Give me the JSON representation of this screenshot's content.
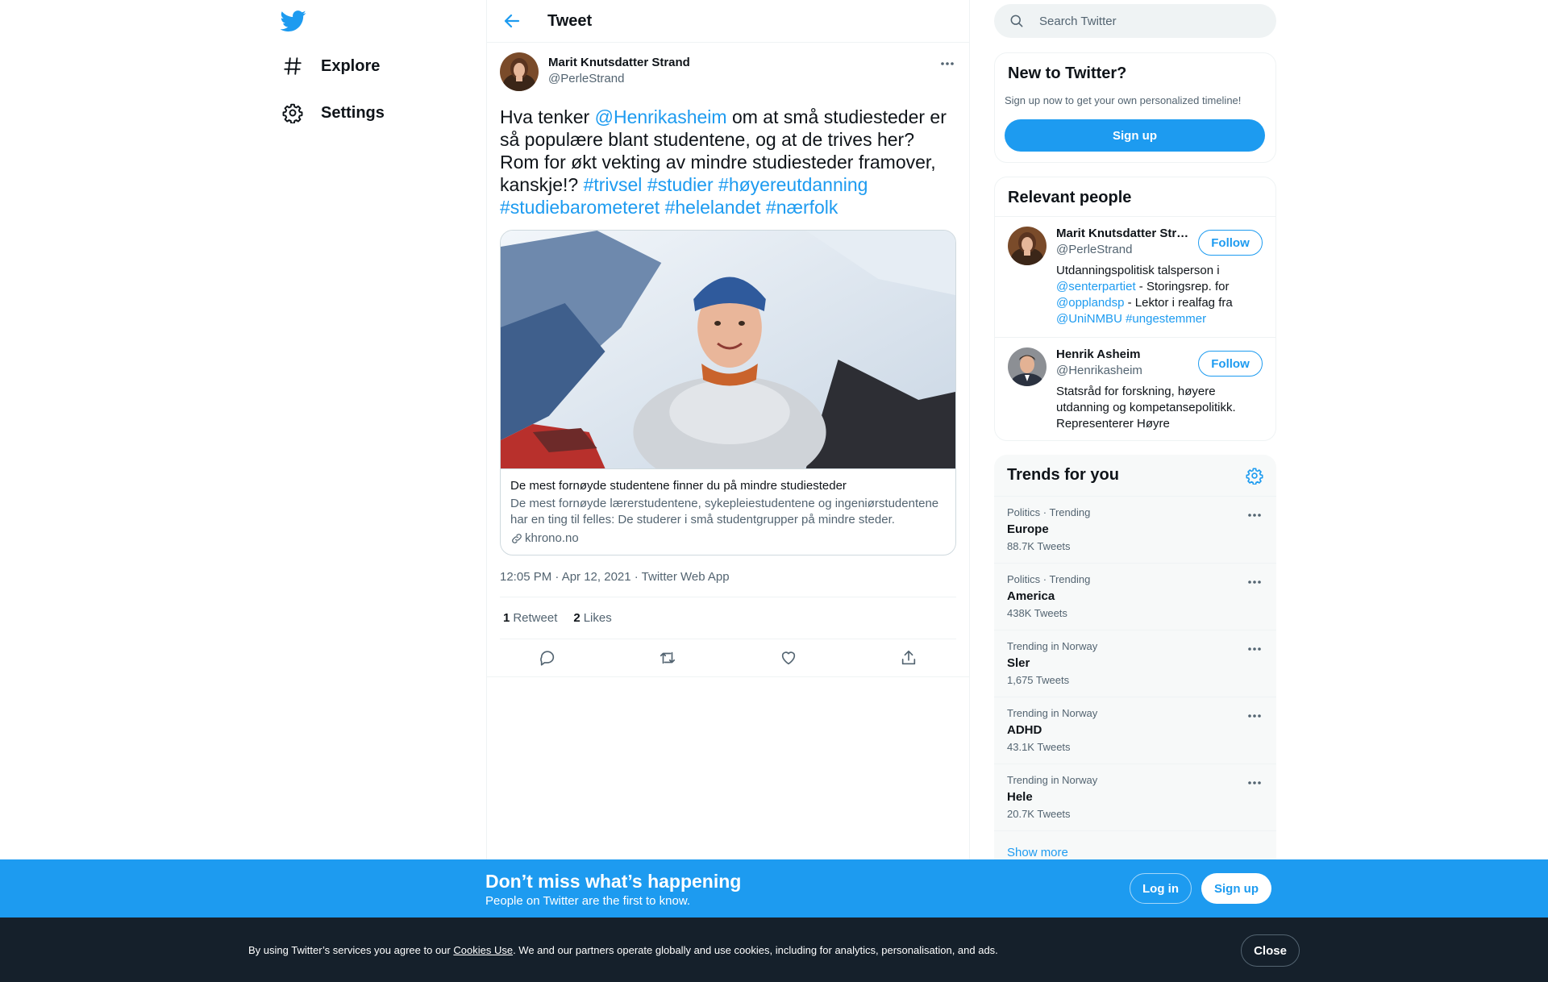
{
  "nav": {
    "items": [
      {
        "label": "Explore"
      },
      {
        "label": "Settings"
      }
    ]
  },
  "header": {
    "title": "Tweet"
  },
  "tweet": {
    "author_name": "Marit Knutsdatter Strand",
    "author_handle": "@PerleStrand",
    "text_parts": {
      "p1": "Hva tenker ",
      "mention": "@Henrikasheim",
      "p2": " om at små studiesteder er så populære blant studentene, og at de trives her? Rom for økt vekting av mindre studiesteder framover, kanskje!? ",
      "h1": "#trivsel",
      "h2": "#studier",
      "h3": "#høyereutdanning",
      "h4": "#studiebarometeret",
      "h5": "#helelandet",
      "h6": "#nærfolk"
    },
    "card": {
      "title": "De mest fornøyde studentene finner du på mindre studiesteder",
      "description": "De mest fornøyde lærerstudentene, sykepleiestudentene og ingeniørstudentene har en ting til felles: De studerer i små studentgrupper på mindre steder.",
      "domain": "khrono.no"
    },
    "meta": "12:05 PM · Apr 12, 2021 · Twitter Web App",
    "retweets_count": "1",
    "retweets_label": "Retweet",
    "likes_count": "2",
    "likes_label": "Likes"
  },
  "search": {
    "placeholder": "Search Twitter"
  },
  "new_to_twitter": {
    "title": "New to Twitter?",
    "subtitle": "Sign up now to get your own personalized timeline!",
    "button": "Sign up"
  },
  "relevant_people": {
    "title": "Relevant people",
    "people": [
      {
        "name": "Marit Knutsdatter Str…",
        "handle": "@PerleStrand",
        "follow": "Follow",
        "bio": {
          "a": "Utdanningspolitisk talsperson i ",
          "m1": "@senterpartiet",
          "b": " - Storingsrep. for ",
          "m2": "@opplandsp",
          "c": " - Lektor i realfag fra ",
          "m3": "@UniNMBU",
          "d": " ",
          "h1": "#ungestemmer"
        }
      },
      {
        "name": "Henrik Asheim",
        "handle": "@Henrikasheim",
        "follow": "Follow",
        "bio": "Statsråd for forskning, høyere utdanning og kompetansepolitikk. Representerer Høyre"
      }
    ]
  },
  "trends": {
    "title": "Trends for you",
    "items": [
      {
        "category": "Politics · Trending",
        "name": "Europe",
        "count": "88.7K Tweets"
      },
      {
        "category": "Politics · Trending",
        "name": "America",
        "count": "438K Tweets"
      },
      {
        "category": "Trending in Norway",
        "name": "Sler",
        "count": "1,675 Tweets"
      },
      {
        "category": "Trending in Norway",
        "name": "ADHD",
        "count": "43.1K Tweets"
      },
      {
        "category": "Trending in Norway",
        "name": "Hele",
        "count": "20.7K Tweets"
      }
    ],
    "show_more": "Show more"
  },
  "bottom_bar": {
    "title": "Don’t miss what’s happening",
    "subtitle": "People on Twitter are the first to know.",
    "login": "Log in",
    "signup": "Sign up"
  },
  "cookie_bar": {
    "text_a": "By using Twitter’s services you agree to our ",
    "link": "Cookies Use",
    "text_b": ". We and our partners operate globally and use cookies, including for analytics, personalisation, and ads.",
    "close": "Close"
  },
  "colors": {
    "accent": "#1d9bf0",
    "text": "#0f1419",
    "secondary": "#536471",
    "cookie_bg": "#15202b"
  }
}
